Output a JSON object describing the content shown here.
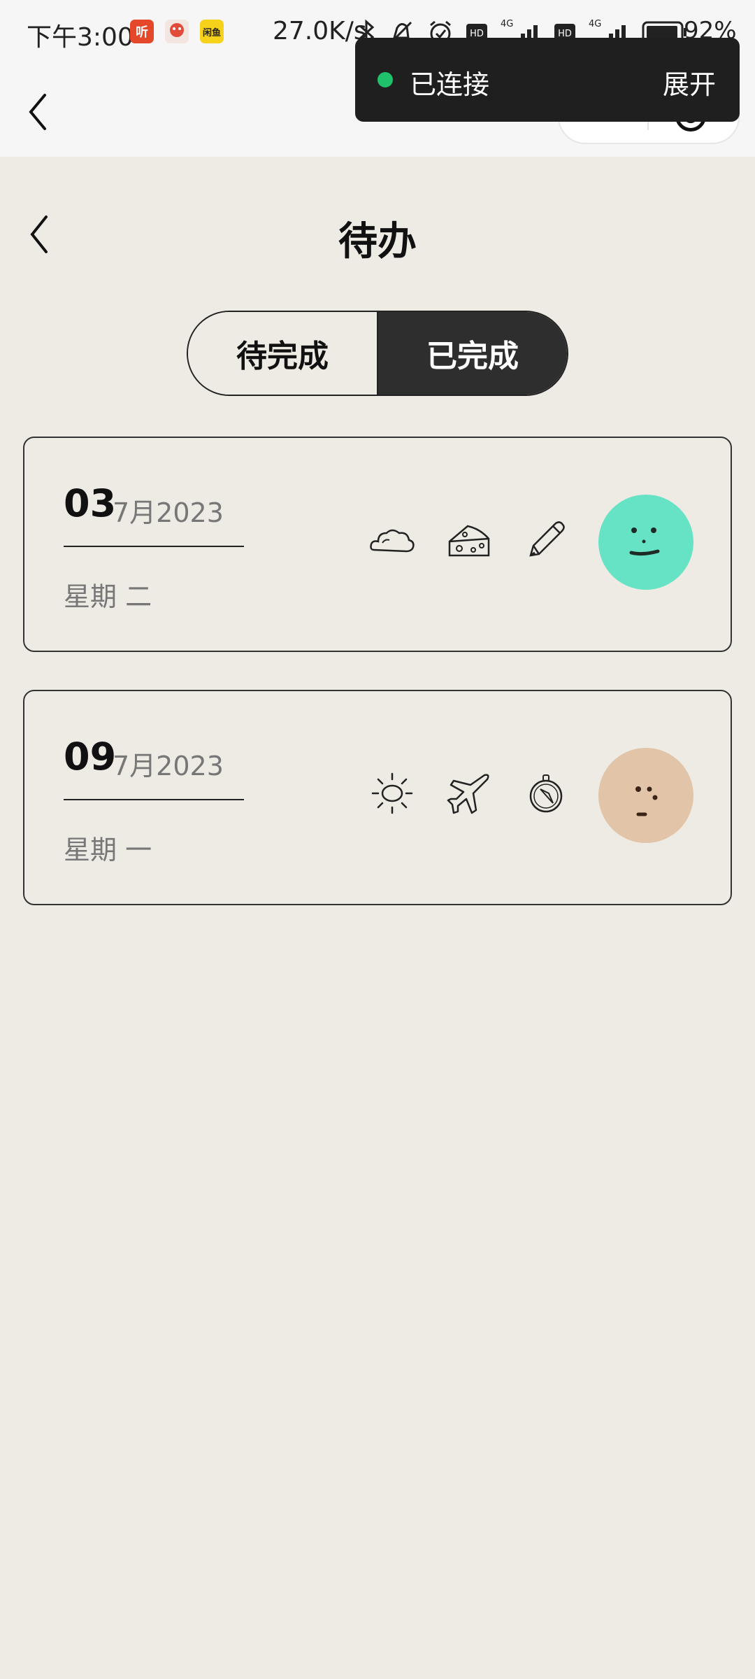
{
  "status_bar": {
    "time": "下午3:00",
    "apps": [
      {
        "icon": "ting-app-icon",
        "label": "听",
        "color": "#e5472a"
      },
      {
        "icon": "mascot-app-icon",
        "label": "",
        "color": "#f0f0f0"
      },
      {
        "icon": "xianyu-app-icon",
        "label": "闲鱼",
        "color": "#f7d21a"
      }
    ],
    "net_speed": "27.0K/s",
    "battery": "92%"
  },
  "toast": {
    "status": "已连接",
    "action": "展开",
    "dot_color": "#1fc26a"
  },
  "page": {
    "title": "待办"
  },
  "tabs": {
    "pending": "待完成",
    "done": "已完成",
    "selected": "已完成"
  },
  "cards": [
    {
      "day": "03",
      "month_year": "7月2023",
      "weekday": "星期 二",
      "icons": [
        "cloud-icon",
        "cheese-icon",
        "pencil-icon"
      ],
      "mood_color": "#66e3c4"
    },
    {
      "day": "09",
      "month_year": "7月2023",
      "weekday": "星期 一",
      "icons": [
        "sun-icon",
        "airplane-icon",
        "compass-icon"
      ],
      "mood_color": "#e2c4a8"
    }
  ]
}
